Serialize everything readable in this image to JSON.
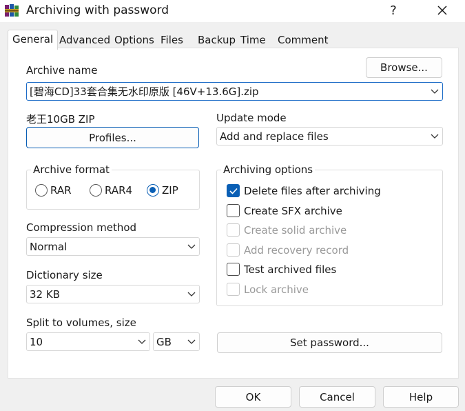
{
  "window": {
    "title": "Archiving with password",
    "help_label": "?",
    "icons": {
      "app": "winrar-books-icon",
      "close": "close-x-icon"
    }
  },
  "tabs": [
    {
      "label": "General",
      "active": true
    },
    {
      "label": "Advanced"
    },
    {
      "label": "Options"
    },
    {
      "label": "Files"
    },
    {
      "label": "Backup"
    },
    {
      "label": "Time"
    },
    {
      "label": "Comment"
    }
  ],
  "general": {
    "archive_name_label": "Archive name",
    "archive_name_value": "[碧海CD]33套合集无水印原版 [46V+13.6G].zip",
    "browse_label": "Browse...",
    "profile_name": "老王10GB ZIP",
    "profiles_label": "Profiles...",
    "update_mode_label": "Update mode",
    "update_mode_value": "Add and replace files",
    "archive_format": {
      "label": "Archive format",
      "options": [
        "RAR",
        "RAR4",
        "ZIP"
      ],
      "selected": "ZIP"
    },
    "compression_method_label": "Compression method",
    "compression_method_value": "Normal",
    "dictionary_size_label": "Dictionary size",
    "dictionary_size_value": "32 KB",
    "split_label": "Split to volumes, size",
    "split_value": "10",
    "split_unit": "GB",
    "archiving_options": {
      "label": "Archiving options",
      "items": [
        {
          "label": "Delete files after archiving",
          "checked": true,
          "enabled": true
        },
        {
          "label": "Create SFX archive",
          "checked": false,
          "enabled": true
        },
        {
          "label": "Create solid archive",
          "checked": false,
          "enabled": false
        },
        {
          "label": "Add recovery record",
          "checked": false,
          "enabled": false
        },
        {
          "label": "Test archived files",
          "checked": false,
          "enabled": true
        },
        {
          "label": "Lock archive",
          "checked": false,
          "enabled": false
        }
      ]
    },
    "set_password_label": "Set password..."
  },
  "footer": {
    "ok_label": "OK",
    "cancel_label": "Cancel",
    "help_label": "Help"
  },
  "colors": {
    "accent": "#0a5fb5",
    "panel": "#ffffff",
    "chrome": "#f0f0f0"
  }
}
